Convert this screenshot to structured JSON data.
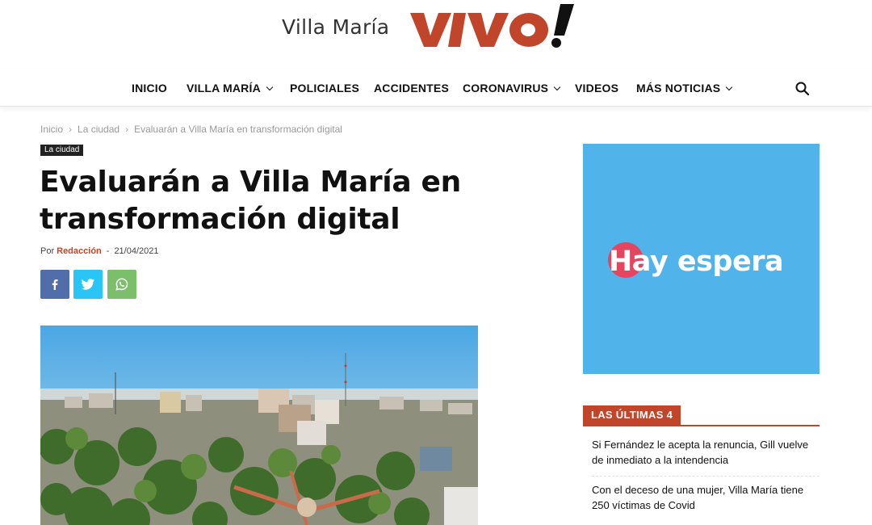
{
  "header": {
    "site_name": "Villa María",
    "brand": "VIVO!",
    "brand_color": "#c0452a"
  },
  "nav": {
    "items": [
      {
        "label": "INICIO",
        "dropdown": false
      },
      {
        "label": "VILLA MARÍA",
        "dropdown": true
      },
      {
        "label": "POLICIALES",
        "dropdown": false
      },
      {
        "label": "ACCIDENTES",
        "dropdown": false
      },
      {
        "label": "CORONAVIRUS",
        "dropdown": true
      },
      {
        "label": "VIDEOS",
        "dropdown": false
      },
      {
        "label": "MÁS NOTICIAS",
        "dropdown": true
      }
    ],
    "search_icon": "search-icon"
  },
  "breadcrumb": {
    "items": [
      "Inicio",
      "La ciudad",
      "Evaluarán a Villa María en transformación digital"
    ],
    "separator": "›"
  },
  "article": {
    "category": "La ciudad",
    "title": "Evaluarán a Villa María en transformación digital",
    "by_label": "Por",
    "author": "Redacción",
    "date": "21/04/2021",
    "share_buttons": [
      {
        "network": "facebook",
        "icon": "facebook-icon",
        "color": "#516eab"
      },
      {
        "network": "twitter",
        "icon": "twitter-icon",
        "color": "#29c5f6"
      },
      {
        "network": "whatsapp",
        "icon": "whatsapp-icon",
        "color": "#7bbf6a"
      }
    ]
  },
  "sidebar": {
    "ad": {
      "text": "Hay espera",
      "background": "#50b3ea"
    },
    "latest": {
      "title": "LAS ÚLTIMAS 4",
      "items": [
        "Si Fernández le acepta la renuncia, Gill vuelve de inmediato a la intendencia",
        "Con el deceso de una mujer, Villa María tiene 250 víctimas de Covid"
      ]
    }
  }
}
